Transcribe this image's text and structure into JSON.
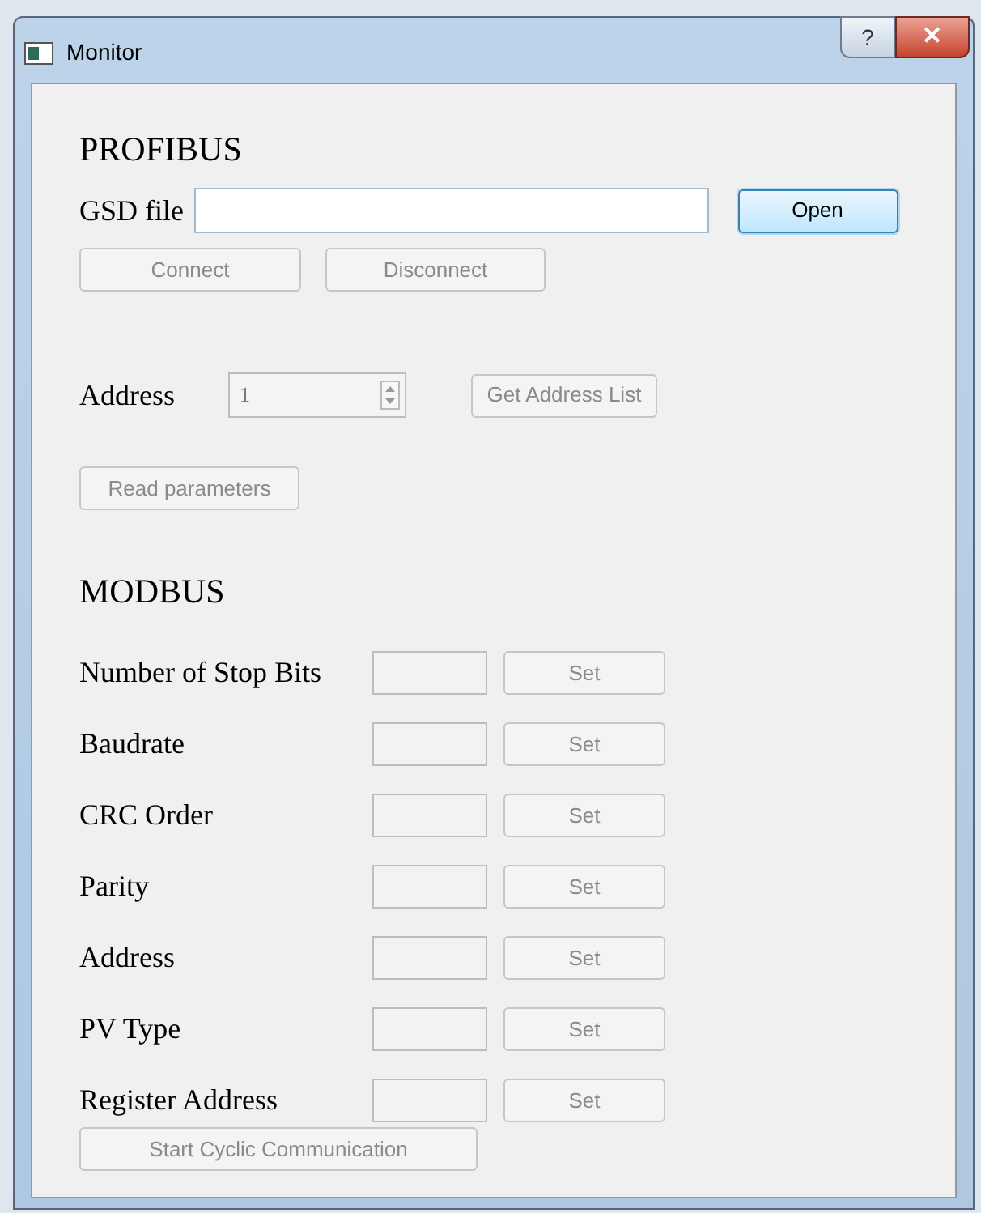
{
  "window": {
    "title": "Monitor",
    "help": "?",
    "close": "✕"
  },
  "profibus": {
    "heading": "PROFIBUS",
    "gsd_label": "GSD file",
    "open": {
      "label": "Open",
      "disabled": false
    },
    "connect": {
      "label": "Connect",
      "disabled": true
    },
    "disconnect": {
      "label": "Disconnect",
      "disabled": true
    },
    "address_label": "Address",
    "address_value": "1",
    "address_disabled": true,
    "get_address_list": {
      "label": "Get Address List",
      "disabled": true
    },
    "read_parameters": {
      "label": "Read parameters",
      "disabled": true
    }
  },
  "modbus": {
    "heading": "MODBUS",
    "rows": [
      {
        "label": "Number of Stop Bits",
        "button": "Set",
        "disabled": true
      },
      {
        "label": "Baudrate",
        "button": "Set",
        "disabled": true
      },
      {
        "label": "CRC Order",
        "button": "Set",
        "disabled": true
      },
      {
        "label": "Parity",
        "button": "Set",
        "disabled": true
      },
      {
        "label": "Address",
        "button": "Set",
        "disabled": true
      },
      {
        "label": "PV Type",
        "button": "Set",
        "disabled": true
      },
      {
        "label": "Register Address",
        "button": "Set",
        "disabled": true
      }
    ],
    "start": {
      "label": "Start Cyclic Communication",
      "disabled": true
    }
  }
}
